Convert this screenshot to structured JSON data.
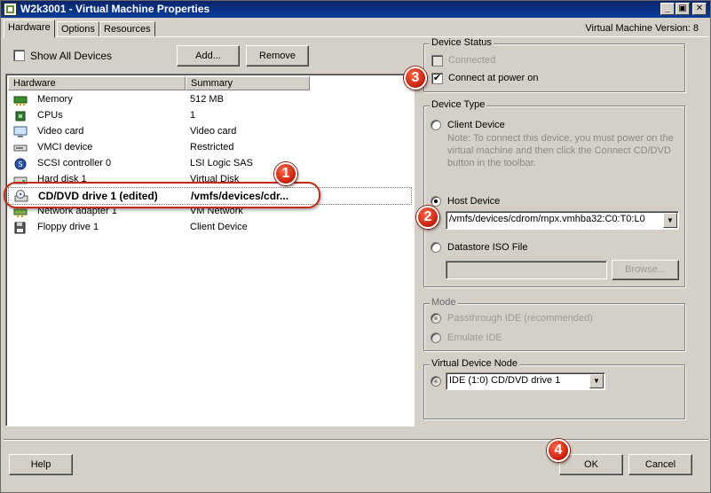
{
  "window": {
    "title": "W2k3001 - Virtual Machine Properties",
    "vm_version": "Virtual Machine Version: 8",
    "controls": {
      "minimize": "_",
      "restore": "▣",
      "close": "✕"
    }
  },
  "tabs": [
    {
      "label": "Hardware",
      "active": true
    },
    {
      "label": "Options",
      "active": false
    },
    {
      "label": "Resources",
      "active": false
    }
  ],
  "hardware_panel": {
    "show_all_devices_label": "Show All Devices",
    "add_button": "Add...",
    "remove_button": "Remove",
    "columns": [
      "Hardware",
      "Summary"
    ],
    "rows": [
      {
        "icon": "memory-icon",
        "name": "Memory",
        "summary": "512 MB"
      },
      {
        "icon": "cpu-icon",
        "name": "CPUs",
        "summary": "1"
      },
      {
        "icon": "video-card-icon",
        "name": "Video card",
        "summary": "Video card"
      },
      {
        "icon": "vmci-device-icon",
        "name": "VMCI device",
        "summary": "Restricted"
      },
      {
        "icon": "scsi-controller-icon",
        "name": "SCSI controller 0",
        "summary": "LSI Logic SAS"
      },
      {
        "icon": "hard-disk-icon",
        "name": "Hard disk 1",
        "summary": "Virtual Disk"
      },
      {
        "icon": "cd-dvd-drive-icon",
        "name": "CD/DVD drive 1 (edited)",
        "summary": "/vmfs/devices/cdr...",
        "selected": true
      },
      {
        "icon": "network-adapter-icon",
        "name": "Network adapter 1",
        "summary": "VM Network"
      },
      {
        "icon": "floppy-drive-icon",
        "name": "Floppy drive 1",
        "summary": "Client Device"
      }
    ]
  },
  "device_status": {
    "title": "Device Status",
    "connected_label": "Connected",
    "connected_checked": false,
    "connect_power_on_label": "Connect at power on",
    "connect_power_on_checked": true
  },
  "device_type": {
    "title": "Device Type",
    "client_device_label": "Client Device",
    "client_note": "Note: To connect this device, you must power on the virtual machine and then click the Connect CD/DVD button in the toolbar.",
    "host_device_label": "Host Device",
    "host_device_value": "/vmfs/devices/cdrom/mpx.vmhba32:C0:T0:L0",
    "datastore_iso_label": "Datastore ISO File",
    "datastore_iso_value": "",
    "browse_button": "Browse...",
    "selected": "Host Device"
  },
  "mode": {
    "title": "Mode",
    "passthrough_label": "Passthrough IDE (recommended)",
    "emulate_label": "Emulate IDE",
    "selected": "Passthrough IDE (recommended)"
  },
  "virtual_device_node": {
    "title": "Virtual Device Node",
    "value": "IDE (1:0) CD/DVD drive 1"
  },
  "footer": {
    "help_button": "Help",
    "ok_button": "OK",
    "cancel_button": "Cancel"
  },
  "callouts": [
    "1",
    "2",
    "3",
    "4"
  ],
  "colors": {
    "title_bar": "#0a246a",
    "callout_red": "#c41d0a",
    "dialog_bg": "#d4d0c8"
  }
}
